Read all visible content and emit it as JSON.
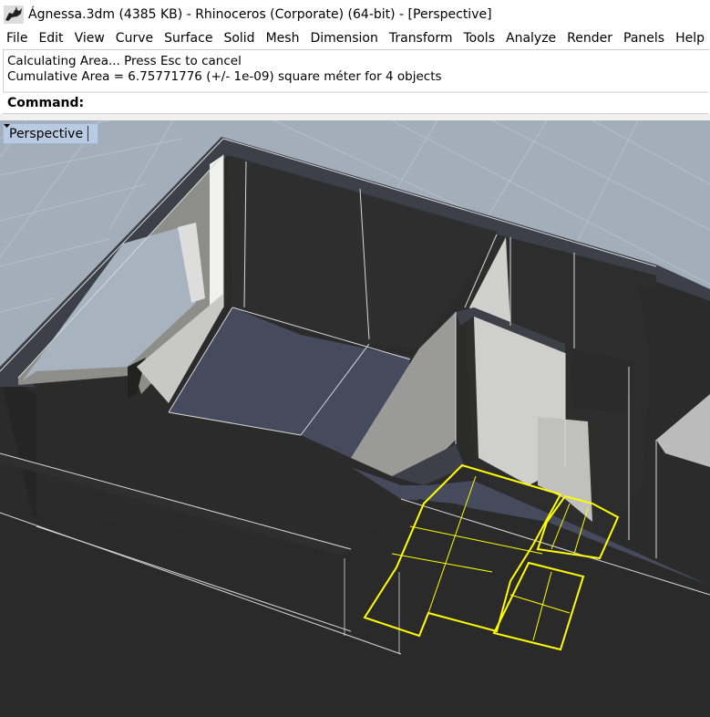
{
  "window": {
    "title": "Ágnessa.3dm (4385 KB) - Rhinoceros (Corporate) (64-bit) - [Perspective]",
    "app_icon": "rhino-icon"
  },
  "menu": [
    "File",
    "Edit",
    "View",
    "Curve",
    "Surface",
    "Solid",
    "Mesh",
    "Dimension",
    "Transform",
    "Tools",
    "Analyze",
    "Render",
    "Panels",
    "Help"
  ],
  "command_history": [
    "Calculating Area... Press Esc to cancel",
    "Cumulative Area = 6.75771776 (+/- 1e-09) square méter for 4 objects"
  ],
  "command": {
    "label": "Command:",
    "value": ""
  },
  "viewport": {
    "tab_label": "Perspective",
    "tab_menu_icon": "dropdown-arrow-icon",
    "background_color": "#a2aeb9",
    "selection_color": "#ffff00",
    "wall_top_color": "#3b3d44",
    "wall_face_color": "#2b2b2b",
    "floor_color": "#454a5c"
  }
}
